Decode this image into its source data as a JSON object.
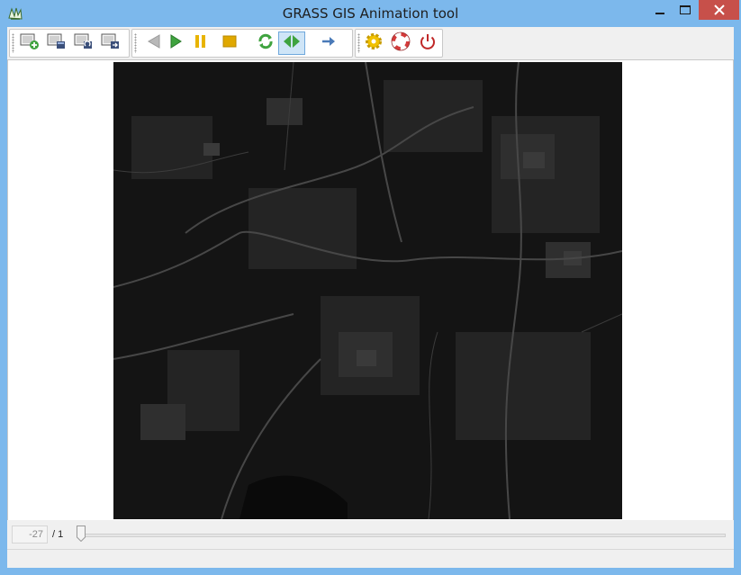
{
  "window": {
    "title": "GRASS GIS Animation tool",
    "accent_color": "#7cb8ec",
    "close_color": "#c7504a"
  },
  "toolbar": {
    "groups": [
      {
        "name": "animation-management",
        "buttons": [
          {
            "icon": "add-animation-icon"
          },
          {
            "icon": "edit-animation-icon"
          },
          {
            "icon": "reload-animation-icon"
          },
          {
            "icon": "export-animation-icon"
          }
        ]
      },
      {
        "name": "playback",
        "buttons": [
          {
            "icon": "play-back-icon"
          },
          {
            "icon": "play-icon"
          },
          {
            "icon": "pause-icon"
          },
          {
            "icon": "stop-icon"
          },
          {
            "icon": "loop-icon"
          },
          {
            "icon": "bounce-icon",
            "active": true
          },
          {
            "icon": "one-direction-icon"
          }
        ]
      },
      {
        "name": "misc",
        "buttons": [
          {
            "icon": "settings-icon"
          },
          {
            "icon": "help-icon"
          },
          {
            "icon": "quit-icon"
          }
        ]
      }
    ]
  },
  "frame_control": {
    "current_value": "-27",
    "total_label": "/ 1",
    "slider_position": 0
  },
  "map": {
    "background": "#121212"
  }
}
